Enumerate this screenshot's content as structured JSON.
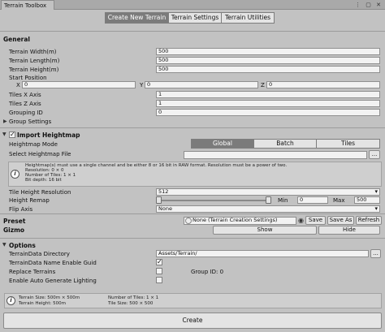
{
  "window": {
    "tab_title": "Terrain Toolbox",
    "icons": "⋮ ▢ ✕"
  },
  "top_tabs": [
    {
      "label": "Create New Terrain"
    },
    {
      "label": "Terrain Settings"
    },
    {
      "label": "Terrain Utilities"
    }
  ],
  "general": {
    "title": "General",
    "width_label": "Terrain Width(m)",
    "width_value": "500",
    "length_label": "Terrain Length(m)",
    "length_value": "500",
    "height_label": "Terrain Height(m)",
    "height_value": "500",
    "start_position_label": "Start Position",
    "x_label": "X",
    "x_value": "0",
    "y_label": "Y",
    "y_value": "0",
    "z_label": "Z",
    "z_value": "0",
    "tiles_x_label": "Tiles X Axis",
    "tiles_x_value": "1",
    "tiles_z_label": "Tiles Z Axis",
    "tiles_z_value": "1",
    "grouping_label": "Grouping ID",
    "grouping_value": "0",
    "group_settings_label": "Group Settings"
  },
  "heightmap": {
    "title": "Import Heightmap",
    "mode_label": "Heightmap Mode",
    "modes": [
      {
        "label": "Global"
      },
      {
        "label": "Batch"
      },
      {
        "label": "Tiles"
      }
    ],
    "select_file_label": "Select Heightmap File",
    "browse_label": "...",
    "help_lines": [
      "Heightmap(s) must use a single channel and be either 8 or 16 bit in RAW format. Resolution must be a power of two.",
      "Resolution: 0 × 0",
      "Number of Tiles: 1 × 1",
      "Bit depth: 16 bit"
    ],
    "tile_res_label": "Tile Height Resolution",
    "tile_res_value": "512",
    "remap_label": "Height Remap",
    "min_label": "Min",
    "min_value": "0",
    "max_label": "Max",
    "max_value": "500",
    "flip_label": "Flip Axis",
    "flip_value": "None"
  },
  "preset": {
    "label": "Preset",
    "value": "None (Terrain Creation Settings)",
    "save_label": "Save",
    "save_as_label": "Save As",
    "refresh_label": "Refresh"
  },
  "gizmo": {
    "label": "Gizmo",
    "show_label": "Show",
    "hide_label": "Hide"
  },
  "options": {
    "title": "Options",
    "dir_label": "TerrainData Directory",
    "dir_value": "Assets/Terrain/",
    "browse_label": "...",
    "guid_label": "TerrainData Name Enable Guid",
    "replace_label": "Replace Terrains",
    "group_id_label": "Group ID: 0",
    "auto_light_label": "Enable Auto Generate Lighting"
  },
  "summary": {
    "size": "Terrain Size: 500m × 500m",
    "height": "Terrain Height: 500m",
    "tiles": "Number of Tiles: 1 × 1",
    "tile_size": "Tile Size: 500 × 500"
  },
  "create_label": "Create"
}
